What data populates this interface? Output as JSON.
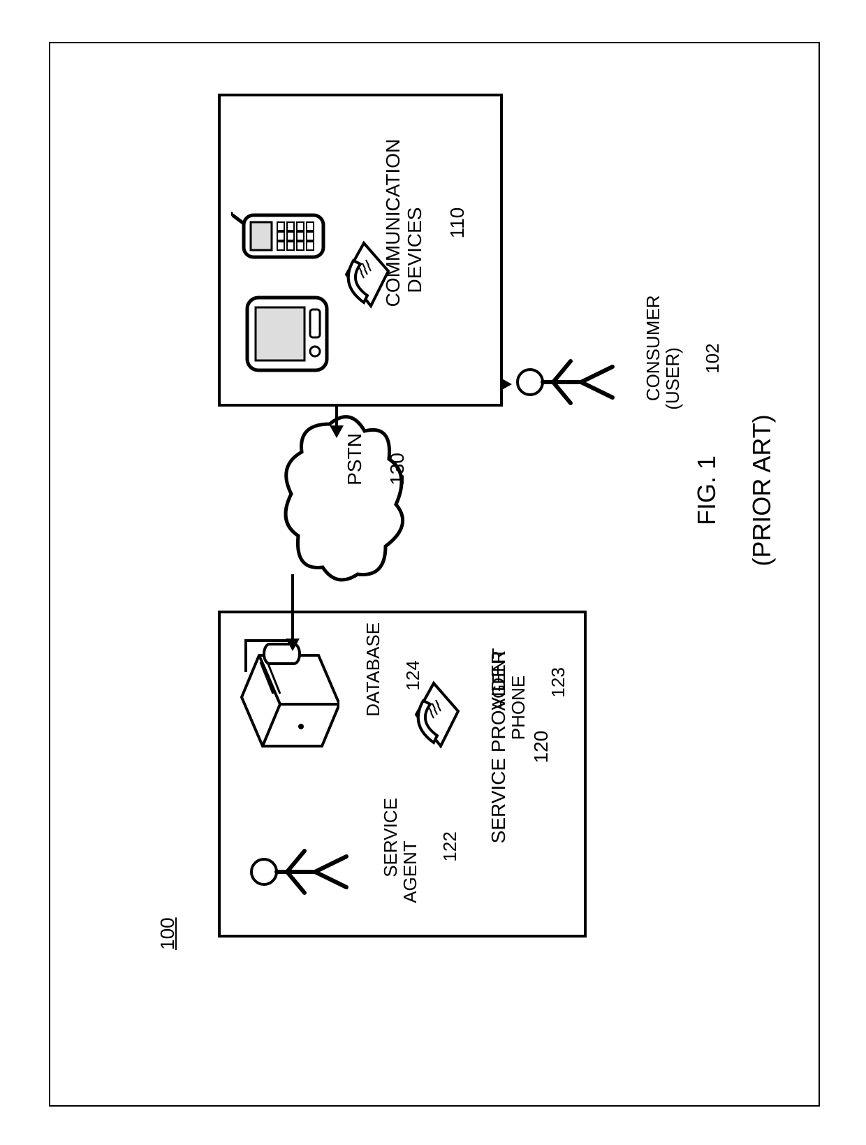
{
  "figure": {
    "ref": "100",
    "caption_line1": "FIG. 1",
    "caption_line2": "(PRIOR ART)"
  },
  "cloud": {
    "label": "PSTN",
    "ref": "130"
  },
  "service_provider": {
    "title": "SERVICE PROVIDER",
    "ref": "120",
    "agent": {
      "label": "SERVICE\nAGENT",
      "ref": "122"
    },
    "database": {
      "label": "DATABASE",
      "ref": "124"
    },
    "agent_phone": {
      "label": "AGENT\nPHONE",
      "ref": "123"
    }
  },
  "consumer": {
    "label": "CONSUMER\n(USER)",
    "ref": "102"
  },
  "comm_devices": {
    "label": "COMMUNICATION\nDEVICES",
    "ref": "110"
  }
}
